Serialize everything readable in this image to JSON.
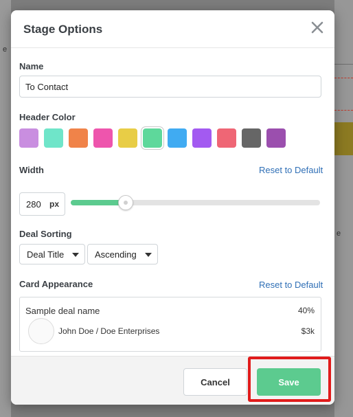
{
  "modal": {
    "title": "Stage Options",
    "name_label": "Name",
    "name_value": "To Contact",
    "header_color_label": "Header Color",
    "colors": [
      "#c98ee0",
      "#6fe5c9",
      "#f08349",
      "#ee55ad",
      "#e8cd46",
      "#5ed89b",
      "#40abf2",
      "#a35af1",
      "#ef6675",
      "#666666",
      "#9b4fae"
    ],
    "selected_color_index": 5,
    "width_label": "Width",
    "width_reset": "Reset to Default",
    "width_value": "280",
    "width_unit": "px",
    "width_slider_fraction": 0.22,
    "deal_sorting_label": "Deal Sorting",
    "sort_field": "Deal Title",
    "sort_order": "Ascending",
    "card_appearance_label": "Card Appearance",
    "card_reset": "Reset to Default",
    "card": {
      "deal_name": "Sample deal name",
      "percent": "40%",
      "person": "John Doe / Doe Enterprises",
      "value": "$3k"
    },
    "cancel_label": "Cancel",
    "save_label": "Save"
  },
  "background": {
    "left_letter": "e",
    "right_letter": "e"
  },
  "colors": {
    "accent": "#5ccb8f",
    "link": "#2f6fb6",
    "highlight": "#e11b1b"
  }
}
